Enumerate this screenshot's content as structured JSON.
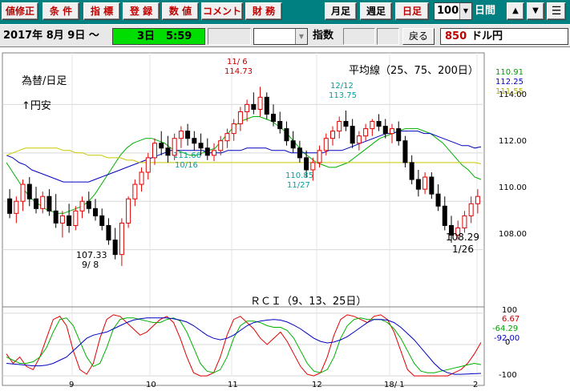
{
  "toolbar": {
    "buttons": [
      {
        "label": "値修正"
      },
      {
        "label": "条 件"
      },
      {
        "label": "指 標"
      },
      {
        "label": "登 録"
      },
      {
        "label": "数 値"
      },
      {
        "label": "コメント"
      },
      {
        "label": "財 務"
      },
      {
        "label": "月足"
      },
      {
        "label": "週足"
      },
      {
        "label": "日足"
      }
    ],
    "zoom_value": "100",
    "period_unit": "日間",
    "up_icon": "up-arrow-icon",
    "down_icon": "down-arrow-icon",
    "menu_icon": "menu-icon"
  },
  "infobar": {
    "date": "2017年 8月 9日 〜",
    "range_days": "3日",
    "range_value": "5:59",
    "indicator_label": "指数",
    "back_label": "戻る",
    "pair_code": "850",
    "pair_name": "ドル円"
  },
  "colors": {
    "toolbar_bg": "#008080",
    "candle_up": "#e00000",
    "candle_down": "#000000",
    "ma25": "#00b000",
    "ma75": "#0000c0",
    "ma200": "#c8c800",
    "range_green": "#00dd00",
    "pair_code_red": "#c00000"
  },
  "chart_data": [
    {
      "type": "candlestick",
      "title": "為替/日足",
      "subtitle": "↑円安",
      "legend_title": "平均線（25、75、200日）",
      "ma_values": [
        "110.91",
        "112.25",
        "111.55"
      ],
      "y_ticks": [
        "114.00",
        "112.00",
        "110.00",
        "108.00"
      ],
      "ylim": [
        106.3,
        115.9
      ],
      "x_ticks": [
        "9",
        "10",
        "11",
        "12",
        "18/ 1",
        "2"
      ],
      "annotations": [
        {
          "text": "11/ 6",
          "x": "11/ 6"
        },
        {
          "text": "114.73",
          "x": "11/ 6"
        },
        {
          "text": "12/12",
          "x": "12/12"
        },
        {
          "text": "113.75",
          "x": "12/12"
        },
        {
          "text": "111.66",
          "x": "10/16"
        },
        {
          "text": "10/16",
          "x": "10/16"
        },
        {
          "text": "110.85",
          "x": "11/27"
        },
        {
          "text": "11/27",
          "x": "11/27"
        },
        {
          "text": "107.33",
          "x": "9/ 8"
        },
        {
          "text": "9/ 8",
          "x": "9/ 8"
        },
        {
          "text": "108.29",
          "x": "1/26"
        },
        {
          "text": "1/26",
          "x": "1/26"
        }
      ],
      "series": [
        {
          "name": "25",
          "values": [
            111.6,
            111.2,
            110.8,
            110.4,
            110.1,
            109.9,
            109.7,
            109.6,
            109.5,
            109.5,
            109.6,
            109.7,
            109.8,
            110.0,
            110.3,
            110.7,
            111.1,
            111.5,
            111.9,
            112.2,
            112.4,
            112.5,
            112.6,
            112.6,
            112.5,
            112.4,
            112.2,
            112.1,
            112.0,
            111.9,
            111.9,
            112.0,
            112.1,
            112.2,
            112.5,
            112.8,
            113.1,
            113.3,
            113.4,
            113.5,
            113.5,
            113.4,
            113.3,
            113.1,
            112.9,
            112.6,
            112.3,
            112.0,
            111.8,
            111.6,
            111.5,
            111.4,
            111.4,
            111.5,
            111.6,
            111.8,
            112.0,
            112.2,
            112.4,
            112.6,
            112.7,
            112.8,
            112.9,
            113.0,
            113.0,
            113.0,
            112.9,
            112.8,
            112.6,
            112.4,
            112.1,
            111.8,
            111.5,
            111.3,
            111.0,
            110.9
          ]
        },
        {
          "name": "75",
          "values": [
            111.9,
            111.8,
            111.6,
            111.5,
            111.3,
            111.2,
            111.1,
            111.0,
            110.9,
            110.8,
            110.8,
            110.8,
            110.8,
            110.8,
            110.9,
            111.0,
            111.1,
            111.2,
            111.3,
            111.4,
            111.5,
            111.6,
            111.7,
            111.8,
            111.9,
            112.0,
            112.1,
            112.1,
            112.1,
            112.1,
            112.1,
            112.1,
            112.0,
            112.0,
            112.0,
            112.1,
            112.1,
            112.1,
            112.2,
            112.2,
            112.2,
            112.2,
            112.1,
            112.1,
            112.1,
            112.0,
            112.0,
            112.0,
            112.0,
            112.0,
            112.0,
            112.1,
            112.1,
            112.1,
            112.2,
            112.3,
            112.4,
            112.5,
            112.6,
            112.7,
            112.8,
            112.8,
            112.9,
            112.9,
            112.9,
            112.9,
            112.8,
            112.8,
            112.7,
            112.6,
            112.5,
            112.4,
            112.3,
            112.3,
            112.2,
            112.25
          ]
        },
        {
          "name": "200",
          "values": [
            111.9,
            112.0,
            112.1,
            112.2,
            112.2,
            112.2,
            112.2,
            112.2,
            112.2,
            112.1,
            112.1,
            112.0,
            112.0,
            111.9,
            111.9,
            111.9,
            111.8,
            111.8,
            111.8,
            111.7,
            111.7,
            111.6,
            111.6,
            111.6,
            111.6,
            111.6,
            111.6,
            111.6,
            111.6,
            111.6,
            111.6,
            111.6,
            111.6,
            111.6,
            111.6,
            111.6,
            111.6,
            111.6,
            111.6,
            111.6,
            111.6,
            111.6,
            111.6,
            111.6,
            111.6,
            111.6,
            111.6,
            111.6,
            111.6,
            111.6,
            111.6,
            111.6,
            111.6,
            111.6,
            111.6,
            111.6,
            111.6,
            111.6,
            111.6,
            111.6,
            111.6,
            111.6,
            111.6,
            111.6,
            111.6,
            111.6,
            111.6,
            111.6,
            111.6,
            111.6,
            111.6,
            111.6,
            111.6,
            111.6,
            111.6,
            111.55
          ]
        }
      ],
      "candles": [
        [
          110.1,
          110.5,
          109.3,
          109.5
        ],
        [
          109.5,
          110.2,
          109.1,
          110.0
        ],
        [
          110.0,
          110.9,
          109.6,
          110.7
        ],
        [
          110.7,
          111.0,
          109.8,
          110.1
        ],
        [
          110.1,
          110.6,
          109.5,
          109.7
        ],
        [
          109.7,
          110.4,
          109.5,
          110.2
        ],
        [
          110.2,
          110.5,
          109.4,
          109.6
        ],
        [
          109.6,
          110.3,
          108.9,
          109.1
        ],
        [
          109.1,
          109.6,
          108.5,
          109.4
        ],
        [
          109.4,
          109.9,
          108.7,
          109.0
        ],
        [
          109.0,
          109.8,
          108.8,
          109.6
        ],
        [
          109.6,
          110.2,
          109.3,
          110.0
        ],
        [
          110.0,
          110.4,
          109.5,
          109.7
        ],
        [
          109.7,
          110.1,
          109.2,
          109.4
        ],
        [
          109.4,
          109.7,
          108.8,
          109.0
        ],
        [
          109.0,
          109.3,
          108.2,
          108.4
        ],
        [
          108.4,
          108.9,
          107.6,
          107.8
        ],
        [
          107.8,
          109.3,
          107.33,
          109.1
        ],
        [
          109.1,
          110.2,
          108.9,
          110.1
        ],
        [
          110.1,
          110.9,
          109.8,
          110.7
        ],
        [
          110.7,
          111.4,
          110.4,
          111.2
        ],
        [
          111.2,
          112.0,
          110.9,
          111.8
        ],
        [
          111.8,
          112.6,
          111.5,
          112.4
        ],
        [
          112.4,
          112.9,
          111.9,
          112.2
        ],
        [
          112.2,
          112.7,
          111.6,
          111.9
        ],
        [
          111.9,
          112.8,
          111.7,
          112.6
        ],
        [
          112.6,
          113.1,
          112.2,
          112.9
        ],
        [
          112.9,
          113.2,
          112.3,
          112.6
        ],
        [
          112.6,
          112.9,
          112.1,
          112.4
        ],
        [
          112.4,
          112.8,
          111.9,
          112.2
        ],
        [
          112.2,
          112.6,
          111.7,
          111.9
        ],
        [
          111.9,
          112.4,
          111.66,
          112.1
        ],
        [
          112.1,
          112.7,
          111.9,
          112.5
        ],
        [
          112.5,
          113.0,
          112.2,
          112.8
        ],
        [
          112.8,
          113.4,
          112.5,
          113.2
        ],
        [
          113.2,
          113.9,
          112.9,
          113.7
        ],
        [
          113.7,
          114.2,
          113.3,
          114.0
        ],
        [
          114.0,
          114.5,
          113.6,
          113.8
        ],
        [
          113.8,
          114.73,
          113.5,
          114.3
        ],
        [
          114.3,
          114.5,
          113.4,
          113.6
        ],
        [
          113.6,
          114.0,
          113.1,
          113.3
        ],
        [
          113.3,
          113.7,
          112.8,
          113.0
        ],
        [
          113.0,
          113.3,
          112.3,
          112.5
        ],
        [
          112.5,
          112.9,
          112.0,
          112.2
        ],
        [
          112.2,
          112.5,
          111.6,
          111.8
        ],
        [
          111.8,
          112.1,
          111.0,
          111.3
        ],
        [
          111.3,
          111.8,
          110.85,
          111.6
        ],
        [
          111.6,
          112.3,
          111.4,
          112.1
        ],
        [
          112.1,
          112.8,
          111.9,
          112.6
        ],
        [
          112.6,
          113.1,
          112.3,
          112.9
        ],
        [
          112.9,
          113.5,
          112.6,
          113.3
        ],
        [
          113.3,
          113.75,
          112.9,
          113.1
        ],
        [
          113.1,
          113.4,
          112.2,
          112.4
        ],
        [
          112.4,
          112.9,
          112.1,
          112.7
        ],
        [
          112.7,
          113.2,
          112.5,
          113.0
        ],
        [
          113.0,
          113.4,
          112.7,
          113.3
        ],
        [
          113.3,
          113.6,
          112.9,
          113.1
        ],
        [
          113.1,
          113.4,
          112.6,
          112.8
        ],
        [
          112.8,
          113.2,
          112.4,
          113.0
        ],
        [
          113.0,
          113.3,
          112.3,
          112.5
        ],
        [
          112.5,
          112.7,
          111.4,
          111.6
        ],
        [
          111.6,
          111.9,
          110.7,
          110.9
        ],
        [
          110.9,
          111.3,
          110.2,
          110.5
        ],
        [
          110.5,
          111.2,
          110.3,
          111.0
        ],
        [
          111.0,
          111.2,
          110.1,
          110.3
        ],
        [
          110.3,
          110.7,
          109.6,
          109.8
        ],
        [
          109.8,
          110.2,
          108.8,
          109.0
        ],
        [
          109.0,
          109.4,
          108.29,
          108.6
        ],
        [
          108.6,
          109.2,
          108.4,
          108.9
        ],
        [
          108.9,
          109.6,
          108.7,
          109.4
        ],
        [
          109.4,
          110.2,
          109.1,
          109.9
        ],
        [
          109.9,
          110.5,
          109.5,
          110.2
        ]
      ]
    },
    {
      "type": "line",
      "title": "ＲＣＩ（9、13、25日）",
      "y_ticks": [
        "100",
        "0",
        "-100"
      ],
      "ylim": [
        -110,
        110
      ],
      "values_label": [
        "6.67",
        "-64.29",
        "-92.00"
      ],
      "series": [
        {
          "name": "9",
          "values": [
            -30,
            -60,
            -40,
            -70,
            -80,
            -40,
            20,
            80,
            90,
            60,
            -20,
            -80,
            -95,
            -60,
            20,
            80,
            95,
            90,
            70,
            50,
            30,
            40,
            60,
            80,
            90,
            70,
            20,
            -40,
            -90,
            -100,
            -100,
            -90,
            -40,
            30,
            80,
            90,
            70,
            50,
            20,
            0,
            20,
            40,
            10,
            -30,
            -70,
            -95,
            -100,
            -90,
            -40,
            30,
            80,
            95,
            90,
            80,
            70,
            90,
            95,
            80,
            40,
            -20,
            -80,
            -100,
            -100,
            -100,
            -100,
            -100,
            -100,
            -90,
            -80,
            -60,
            -30,
            6.67
          ]
        },
        {
          "name": "13",
          "values": [
            -40,
            -50,
            -60,
            -60,
            -55,
            -40,
            -10,
            40,
            80,
            85,
            60,
            10,
            -40,
            -70,
            -60,
            -10,
            50,
            80,
            85,
            85,
            80,
            75,
            70,
            70,
            80,
            85,
            75,
            40,
            -10,
            -60,
            -85,
            -90,
            -80,
            -40,
            20,
            60,
            75,
            75,
            70,
            60,
            55,
            55,
            45,
            20,
            -20,
            -60,
            -85,
            -90,
            -80,
            -40,
            20,
            60,
            80,
            85,
            80,
            80,
            80,
            70,
            50,
            20,
            -20,
            -60,
            -85,
            -90,
            -90,
            -85,
            -80,
            -75,
            -70,
            -65,
            -60,
            -64.29
          ]
        },
        {
          "name": "25",
          "values": [
            -60,
            -62,
            -64,
            -66,
            -68,
            -68,
            -66,
            -60,
            -50,
            -40,
            -20,
            0,
            20,
            30,
            35,
            40,
            50,
            60,
            70,
            78,
            82,
            85,
            85,
            85,
            85,
            82,
            78,
            72,
            60,
            45,
            30,
            20,
            15,
            20,
            30,
            45,
            60,
            70,
            75,
            78,
            80,
            78,
            72,
            62,
            50,
            35,
            20,
            10,
            5,
            8,
            15,
            25,
            40,
            55,
            70,
            80,
            80,
            78,
            70,
            55,
            35,
            15,
            -10,
            -35,
            -60,
            -80,
            -90,
            -95,
            -95,
            -94,
            -93,
            -92
          ]
        }
      ]
    }
  ]
}
